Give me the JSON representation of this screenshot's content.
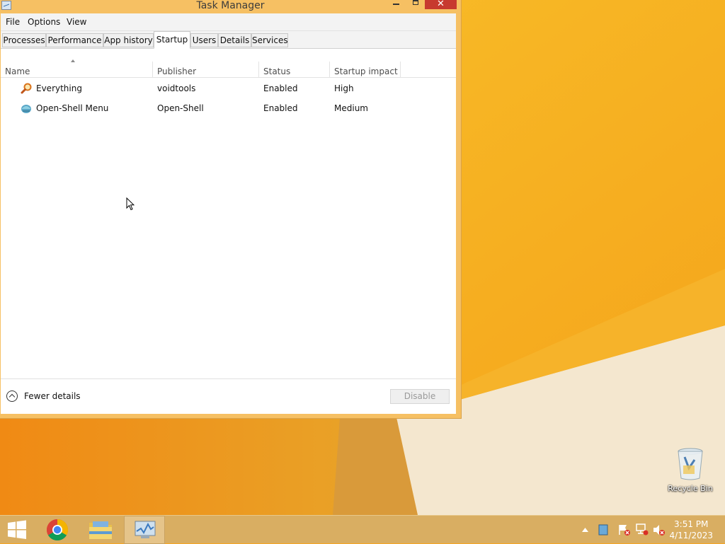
{
  "window": {
    "title": "Task Manager",
    "close_glyph": "✕"
  },
  "menu": [
    "File",
    "Options",
    "View"
  ],
  "tabs": [
    "Processes",
    "Performance",
    "App history",
    "Startup",
    "Users",
    "Details",
    "Services"
  ],
  "active_tab": "Startup",
  "columns": {
    "name": "Name",
    "publisher": "Publisher",
    "status": "Status",
    "impact": "Startup impact"
  },
  "rows": [
    {
      "name": "Everything",
      "publisher": "voidtools",
      "status": "Enabled",
      "impact": "High",
      "icon": "magnifier-icon"
    },
    {
      "name": "Open-Shell Menu",
      "publisher": "Open-Shell",
      "status": "Enabled",
      "impact": "Medium",
      "icon": "shell-icon"
    }
  ],
  "footer": {
    "fewer_details": "Fewer details",
    "disable": "Disable"
  },
  "desktop": {
    "recycle_bin": "Recycle Bin"
  },
  "taskbar": {
    "items": [
      "start-button",
      "chrome",
      "file-explorer",
      "task-manager"
    ],
    "time": "3:51 PM",
    "date": "4/11/2023"
  },
  "colors": {
    "wallpaper": "#f5a623",
    "close_button": "#c7392f",
    "taskbar": "#d9ae62"
  }
}
